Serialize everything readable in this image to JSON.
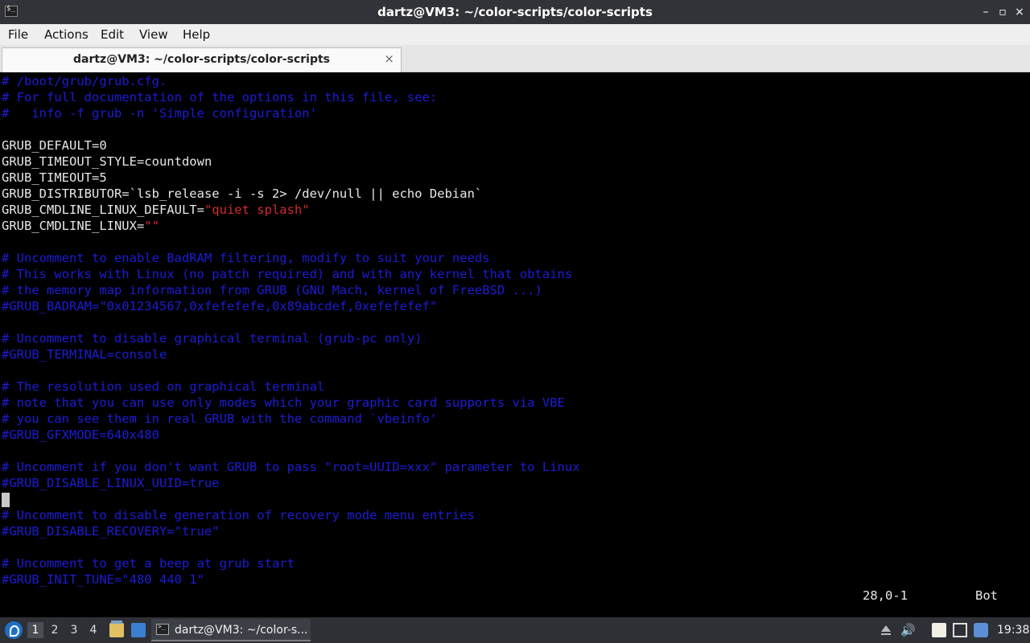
{
  "window": {
    "title": "dartz@VM3: ~/color-scripts/color-scripts",
    "minimize_glyph": "–",
    "maximize_glyph": "▫",
    "close_glyph": "×"
  },
  "menu": {
    "items": [
      "File",
      "Actions",
      "Edit",
      "View",
      "Help"
    ]
  },
  "tab": {
    "label": "dartz@VM3: ~/color-scripts/color-scripts",
    "close_glyph": "×"
  },
  "terminal": {
    "colors": {
      "comment": "#1c1cd6",
      "string": "#d42a2a",
      "text": "#e8e8e8",
      "background": "#000000"
    },
    "lines": [
      {
        "kind": "comment",
        "text": "# /boot/grub/grub.cfg."
      },
      {
        "kind": "comment",
        "text": "# For full documentation of the options in this file, see:"
      },
      {
        "kind": "comment",
        "text": "#   info -f grub -n 'Simple configuration'"
      },
      {
        "kind": "blank",
        "text": ""
      },
      {
        "kind": "plain",
        "text": "GRUB_DEFAULT=0"
      },
      {
        "kind": "plain",
        "text": "GRUB_TIMEOUT_STYLE=countdown"
      },
      {
        "kind": "plain",
        "text": "GRUB_TIMEOUT=5"
      },
      {
        "kind": "plain",
        "text": "GRUB_DISTRIBUTOR=`lsb_release -i -s 2> /dev/null || echo Debian`"
      },
      {
        "kind": "assign",
        "key": "GRUB_CMDLINE_LINUX_DEFAULT=",
        "value": "\"quiet splash\""
      },
      {
        "kind": "assign",
        "key": "GRUB_CMDLINE_LINUX=",
        "value": "\"\""
      },
      {
        "kind": "blank",
        "text": ""
      },
      {
        "kind": "comment",
        "text": "# Uncomment to enable BadRAM filtering, modify to suit your needs"
      },
      {
        "kind": "comment",
        "text": "# This works with Linux (no patch required) and with any kernel that obtains"
      },
      {
        "kind": "comment",
        "text": "# the memory map information from GRUB (GNU Mach, kernel of FreeBSD ...)"
      },
      {
        "kind": "comment",
        "text": "#GRUB_BADRAM=\"0x01234567,0xfefefefe,0x89abcdef,0xefefefef\""
      },
      {
        "kind": "blank",
        "text": ""
      },
      {
        "kind": "comment",
        "text": "# Uncomment to disable graphical terminal (grub-pc only)"
      },
      {
        "kind": "comment",
        "text": "#GRUB_TERMINAL=console"
      },
      {
        "kind": "blank",
        "text": ""
      },
      {
        "kind": "comment",
        "text": "# The resolution used on graphical terminal"
      },
      {
        "kind": "comment",
        "text": "# note that you can use only modes which your graphic card supports via VBE"
      },
      {
        "kind": "comment",
        "text": "# you can see them in real GRUB with the command `vbeinfo'"
      },
      {
        "kind": "comment",
        "text": "#GRUB_GFXMODE=640x480"
      },
      {
        "kind": "blank",
        "text": ""
      },
      {
        "kind": "comment",
        "text": "# Uncomment if you don't want GRUB to pass \"root=UUID=xxx\" parameter to Linux"
      },
      {
        "kind": "comment",
        "text": "#GRUB_DISABLE_LINUX_UUID=true"
      },
      {
        "kind": "blank",
        "text": ""
      },
      {
        "kind": "comment",
        "text": "# Uncomment to disable generation of recovery mode menu entries"
      },
      {
        "kind": "comment",
        "text": "#GRUB_DISABLE_RECOVERY=\"true\""
      },
      {
        "kind": "blank",
        "text": ""
      },
      {
        "kind": "comment",
        "text": "# Uncomment to get a beep at grub start"
      },
      {
        "kind": "comment",
        "text": "#GRUB_INIT_TUNE=\"480 440 1\""
      }
    ],
    "status_position": "28,0-1",
    "status_scroll": "Bot"
  },
  "taskbar": {
    "workspaces": [
      "1",
      "2",
      "3",
      "4"
    ],
    "active_workspace": "1",
    "task_label": "dartz@VM3: ~/color-s...",
    "volume_glyph": "🔊",
    "clock": "19:38",
    "icons": [
      "start-menu-icon",
      "file-manager-icon",
      "show-desktop-icon",
      "terminal-icon",
      "tray-arrow-icon",
      "volume-icon",
      "clipboard-icon",
      "network-icon",
      "updates-icon"
    ]
  }
}
